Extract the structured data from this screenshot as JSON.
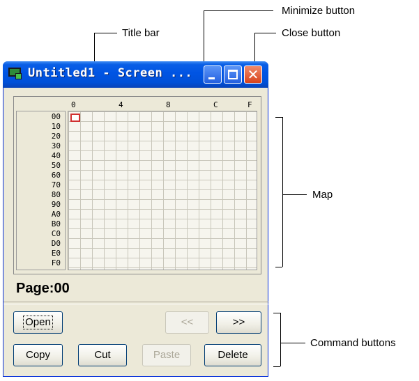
{
  "annotations": {
    "title_bar": "Title bar",
    "minimize_button": "Minimize button",
    "close_button": "Close button",
    "map": "Map",
    "command_buttons": "Command buttons"
  },
  "window": {
    "title": "Untitled1 - Screen ...",
    "titlebar_color": "#0054e3",
    "close_color": "#d8431c"
  },
  "map": {
    "column_labels": [
      "0",
      "4",
      "8",
      "C",
      "F"
    ],
    "row_labels": [
      "00",
      "10",
      "20",
      "30",
      "40",
      "50",
      "60",
      "70",
      "80",
      "90",
      "A0",
      "B0",
      "C0",
      "D0",
      "E0",
      "F0"
    ],
    "selected_cell": {
      "row": "00",
      "column": "0"
    }
  },
  "page_label": "Page:00",
  "buttons": {
    "open": "Open",
    "prev": "<<",
    "next": ">>",
    "copy": "Copy",
    "cut": "Cut",
    "paste": "Paste",
    "delete": "Delete"
  }
}
